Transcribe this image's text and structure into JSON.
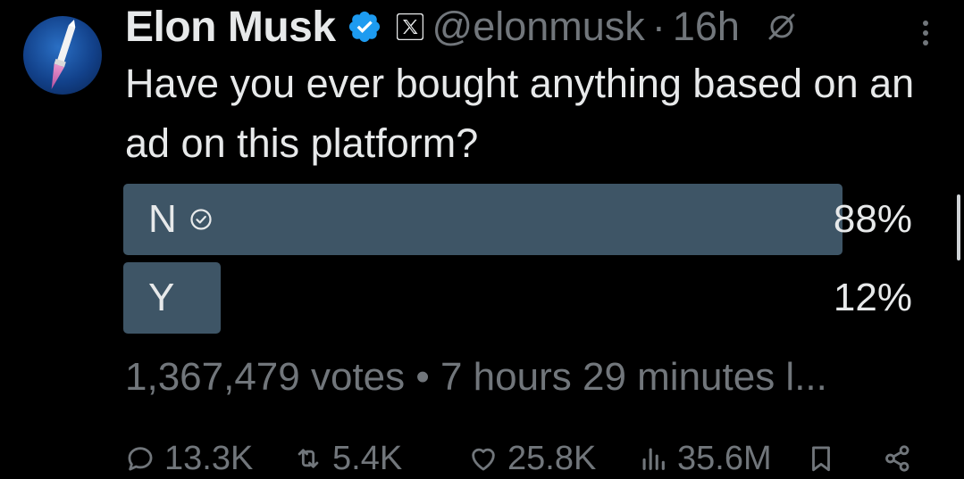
{
  "author": {
    "name": "Elon Musk",
    "handle": "@elonmusk",
    "separator": "·",
    "time": "16h"
  },
  "tweet": {
    "text": "Have you ever bought anything based on an ad on this platform?"
  },
  "poll": {
    "options": [
      {
        "label": "N",
        "percent_text": "88%",
        "percent": 88,
        "winner": true
      },
      {
        "label": "Y",
        "percent_text": "12%",
        "percent": 12,
        "winner": false
      }
    ],
    "meta": "1,367,479 votes • 7 hours 29 minutes l..."
  },
  "stats": {
    "replies": "13.3K",
    "reposts": "5.4K",
    "likes": "25.8K",
    "views": "35.6M"
  },
  "colors": {
    "background": "#000000",
    "text": "#e7e9ea",
    "muted": "#71767b",
    "poll_bar": "#3e5566",
    "verified": "#1d9bf0"
  },
  "icons": [
    "verified-badge-icon",
    "x-logo-icon",
    "grok-icon",
    "more-icon",
    "check-circle-icon",
    "reply-icon",
    "repost-icon",
    "like-icon",
    "views-icon",
    "bookmark-icon",
    "share-icon"
  ]
}
